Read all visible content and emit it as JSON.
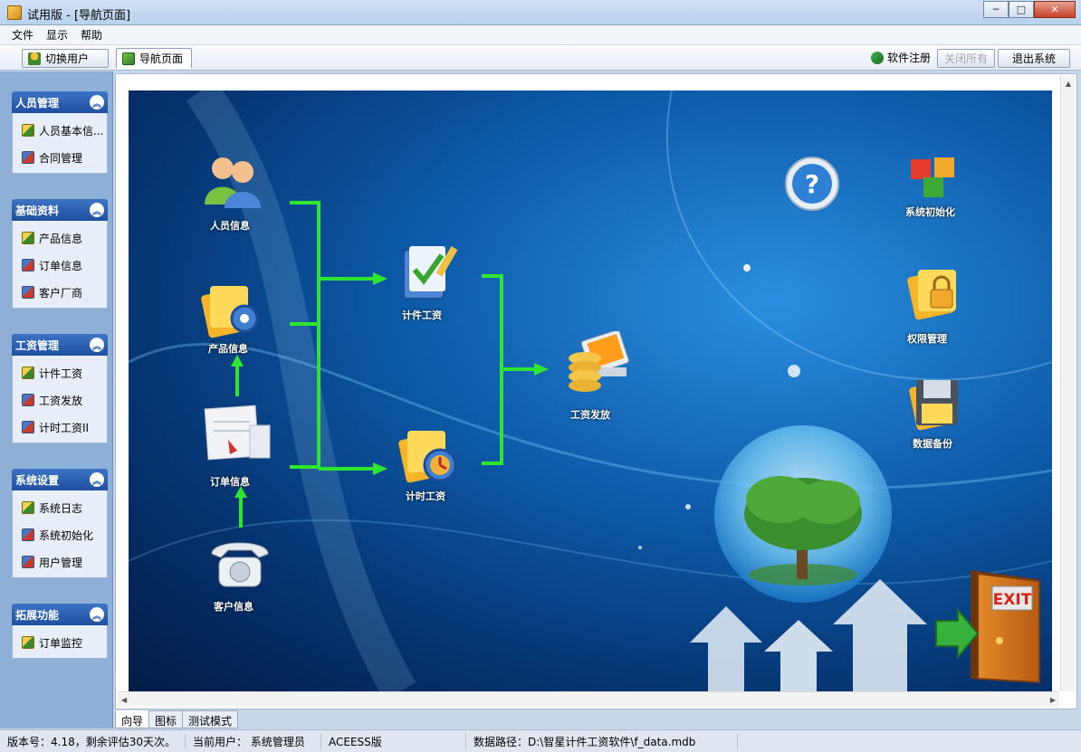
{
  "window": {
    "title": "试用版 - [导航页面]",
    "minimize": "─",
    "maximize": "□",
    "close": "✕"
  },
  "menu": [
    "文件",
    "显示",
    "帮助"
  ],
  "toolbar": {
    "switch_user": "切换用户",
    "nav_tab": "导航页面",
    "register": "软件注册",
    "close_all": "关闭所有",
    "exit_system": "退出系统"
  },
  "sidebar": {
    "groups": [
      {
        "title": "人员管理",
        "items": [
          "人员基本信...",
          "合同管理"
        ]
      },
      {
        "title": "基础资料",
        "items": [
          "产品信息",
          "订单信息",
          "客户厂商"
        ]
      },
      {
        "title": "工资管理",
        "items": [
          "计件工资",
          "工资发放",
          "计时工资II"
        ]
      },
      {
        "title": "系统设置",
        "items": [
          "系统日志",
          "系统初始化",
          "用户管理"
        ]
      },
      {
        "title": "拓展功能",
        "items": [
          "订单监控"
        ]
      }
    ]
  },
  "nav": {
    "personnel": "人员信息",
    "product": "产品信息",
    "order": "订单信息",
    "customer": "客户信息",
    "piece_wage": "计件工资",
    "time_wage": "计时工资",
    "payroll": "工资发放",
    "sys_init": "系统初始化",
    "permission": "权限管理",
    "backup": "数据备份",
    "exit_sign": "EXIT"
  },
  "bottom_tabs": [
    "向导",
    "图标",
    "测试模式"
  ],
  "status": {
    "version": "版本号：4.18，剩余评估30天次。",
    "user": "当前用户：  系统管理员",
    "edition": "ACEESS版",
    "path": "数据路径：D:\\智星计件工资软件\\f_data.mdb"
  },
  "colors": {
    "accent": "#1f4fa0",
    "flow_arrow": "#2ee62e",
    "canvas_bg": "#0d5aa8"
  }
}
